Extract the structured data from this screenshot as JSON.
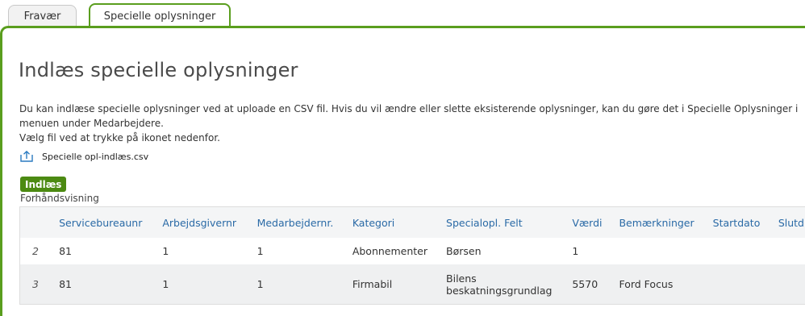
{
  "tabs": [
    {
      "label": "Fravær",
      "active": false
    },
    {
      "label": "Specielle oplysninger",
      "active": true
    }
  ],
  "page_title": "Indlæs specielle oplysninger",
  "description": {
    "line1": "Du kan indlæse specielle oplysninger ved at uploade en CSV fil. Hvis du vil ændre eller slette eksisterende oplysninger, kan du gøre det i Specielle Oplysninger i menuen under Medarbejdere.",
    "line2": "Vælg fil ved at trykke på ikonet nedenfor."
  },
  "file": {
    "name": "Specielle opl-indlæs.csv",
    "icon": "upload-icon"
  },
  "load_button": "Indlæs",
  "preview_label": "Forhåndsvisning",
  "table": {
    "columns": [
      "",
      "Servicebureaunr",
      "Arbejdsgivernr",
      "Medarbejdernr.",
      "Kategori",
      "Specialopl. Felt",
      "Værdi",
      "Bemærkninger",
      "Startdato",
      "Slutd"
    ],
    "rows": [
      [
        "2",
        "81",
        "1",
        "1",
        "Abonnementer",
        "Børsen",
        "1",
        "",
        "",
        ""
      ],
      [
        "3",
        "81",
        "1",
        "1",
        "Firmabil",
        "Bilens beskatningsgrundlag",
        "5570",
        "Ford Focus",
        "",
        ""
      ]
    ]
  },
  "colors": {
    "accent_green": "#5a9e1e",
    "button_green": "#4c8a12",
    "header_blue": "#2a6aa6"
  }
}
